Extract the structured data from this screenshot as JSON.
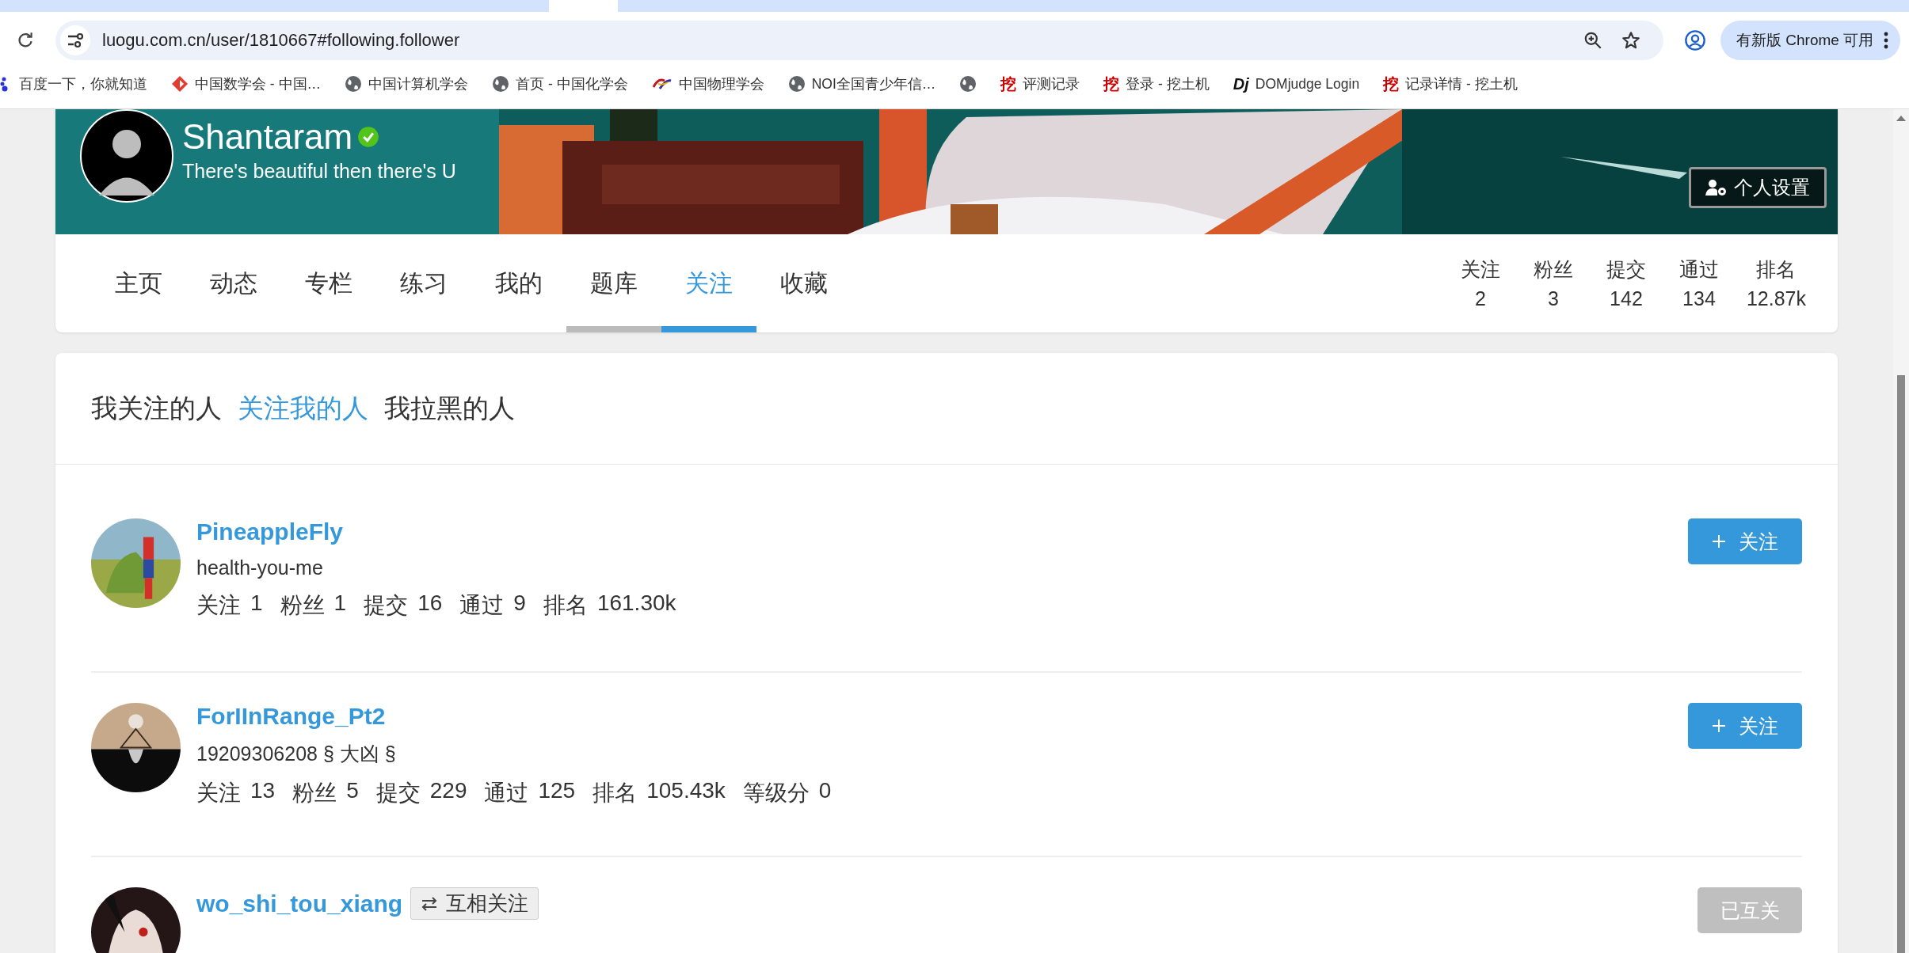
{
  "browser": {
    "url": "luogu.com.cn/user/1810667#following.follower",
    "update_button": "有新版 Chrome 可用",
    "bookmarks": [
      {
        "kind": "baidu",
        "label": "百度一下，你就知道"
      },
      {
        "kind": "diamond",
        "label": "中国数学会 - 中国…"
      },
      {
        "kind": "globe",
        "label": "中国计算机学会"
      },
      {
        "kind": "globe",
        "label": "首页 - 中国化学会"
      },
      {
        "kind": "cps",
        "label": "中国物理学会"
      },
      {
        "kind": "globe",
        "label": "NOI全国青少年信…"
      },
      {
        "kind": "globe"
      },
      {
        "kind": "text",
        "icon_text": "挖",
        "label": "评测记录"
      },
      {
        "kind": "text",
        "icon_text": "挖",
        "label": "登录 - 挖土机"
      },
      {
        "kind": "dj",
        "icon_text": "Dj",
        "label": "DOMjudge Login"
      },
      {
        "kind": "text",
        "icon_text": "挖",
        "label": "记录详情 - 挖土机"
      }
    ]
  },
  "profile": {
    "name": "Shantaram",
    "verified": true,
    "motto": "There's beautiful then there's U",
    "settings_button": "个人设置",
    "tabs": [
      {
        "label": "主页",
        "selected": false,
        "hovered": false
      },
      {
        "label": "动态",
        "selected": false,
        "hovered": false
      },
      {
        "label": "专栏",
        "selected": false,
        "hovered": false
      },
      {
        "label": "练习",
        "selected": false,
        "hovered": false
      },
      {
        "label": "我的",
        "selected": false,
        "hovered": false
      },
      {
        "label": "题库",
        "selected": false,
        "hovered": true
      },
      {
        "label": "关注",
        "selected": true,
        "hovered": false
      },
      {
        "label": "收藏",
        "selected": false,
        "hovered": false
      }
    ],
    "stats": [
      {
        "label": "关注",
        "value": "2"
      },
      {
        "label": "粉丝",
        "value": "3"
      },
      {
        "label": "提交",
        "value": "142"
      },
      {
        "label": "通过",
        "value": "134"
      },
      {
        "label": "排名",
        "value": "12.87k"
      }
    ]
  },
  "follow_tabs": [
    {
      "label": "我关注的人",
      "selected": false
    },
    {
      "label": "关注我的人",
      "selected": true
    },
    {
      "label": "我拉黑的人",
      "selected": false
    }
  ],
  "users": [
    {
      "name": "PineappleFly",
      "bio": "health-you-me",
      "stats": [
        {
          "label": "关注",
          "value": "1"
        },
        {
          "label": "粉丝",
          "value": "1"
        },
        {
          "label": "提交",
          "value": "16"
        },
        {
          "label": "通过",
          "value": "9"
        },
        {
          "label": "排名",
          "value": "161.30k"
        }
      ],
      "button": {
        "kind": "follow",
        "label": "关注"
      }
    },
    {
      "name": "ForIInRange_Pt2",
      "bio": "19209306208 § 大凶 §",
      "stats": [
        {
          "label": "关注",
          "value": "13"
        },
        {
          "label": "粉丝",
          "value": "5"
        },
        {
          "label": "提交",
          "value": "229"
        },
        {
          "label": "通过",
          "value": "125"
        },
        {
          "label": "排名",
          "value": "105.43k"
        },
        {
          "label": "等级分",
          "value": "0"
        }
      ],
      "button": {
        "kind": "follow",
        "label": "关注"
      }
    },
    {
      "name": "wo_shi_tou_xiang",
      "mutual_badge": "互相关注",
      "button": {
        "kind": "mutual",
        "label": "已互关"
      }
    }
  ]
}
